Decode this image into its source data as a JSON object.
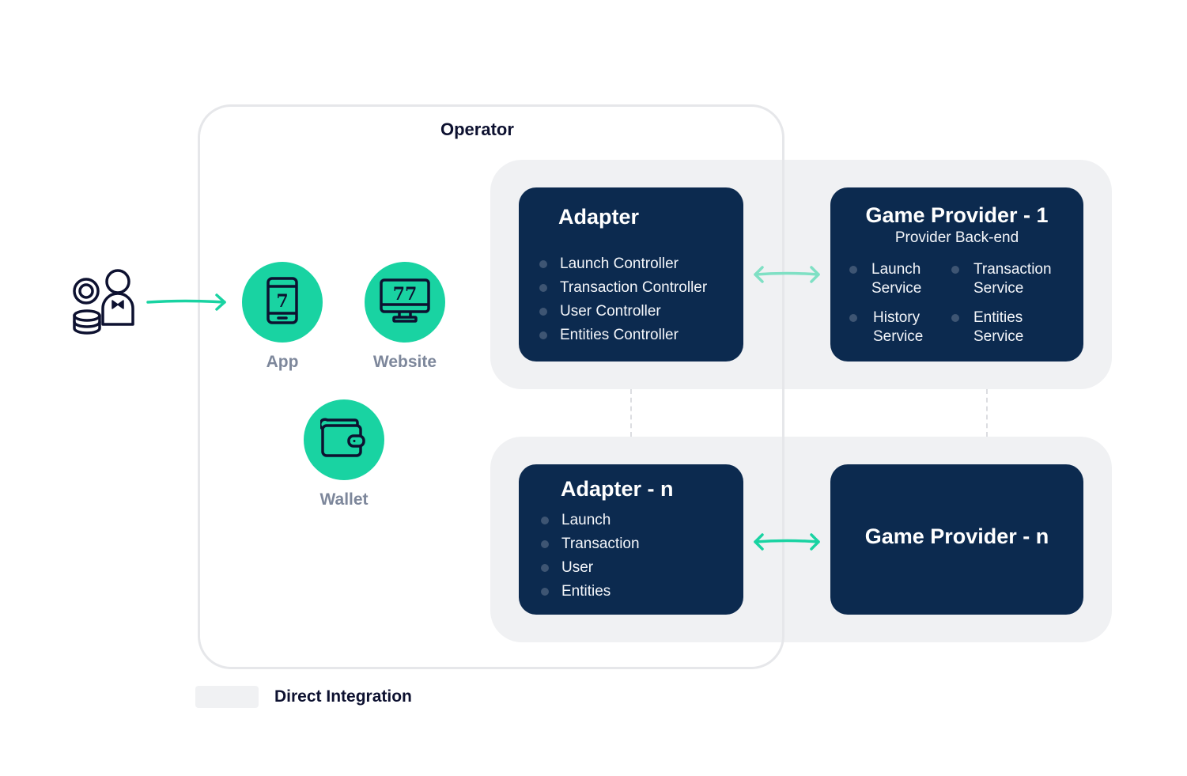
{
  "operator": {
    "title": "Operator"
  },
  "player": {
    "icon": "player-with-chips-icon"
  },
  "channels": [
    {
      "label": "App",
      "icon": "mobile-slot-icon",
      "glyph": "7"
    },
    {
      "label": "Website",
      "icon": "desktop-slot-icon",
      "glyph": "77"
    },
    {
      "label": "Wallet",
      "icon": "wallet-icon"
    }
  ],
  "adapter_1": {
    "title": "Adapter",
    "items": [
      "Launch Controller",
      "Transaction Controller",
      "User Controller",
      "Entities Controller"
    ]
  },
  "provider_1": {
    "title": "Game Provider - 1",
    "subtitle": "Provider Back-end",
    "services": [
      {
        "line1": "Launch",
        "line2": "Service"
      },
      {
        "line1": "Transaction",
        "line2": "Service"
      },
      {
        "line1": "History",
        "line2": "Service"
      },
      {
        "line1": "Entities",
        "line2": "Service"
      }
    ]
  },
  "adapter_n": {
    "title": "Adapter - n",
    "items": [
      "Launch",
      "Transaction",
      "User",
      "Entities"
    ]
  },
  "provider_n": {
    "title": "Game Provider - n"
  },
  "legend": {
    "label": "Direct Integration",
    "swatch_color": "#f0f1f3"
  },
  "colors": {
    "accent": "#19d3a2",
    "card": "#0c2a4f",
    "group_bg": "#f0f1f3",
    "label_gray": "#7d879b",
    "arrow_light": "#7fe0c4"
  }
}
